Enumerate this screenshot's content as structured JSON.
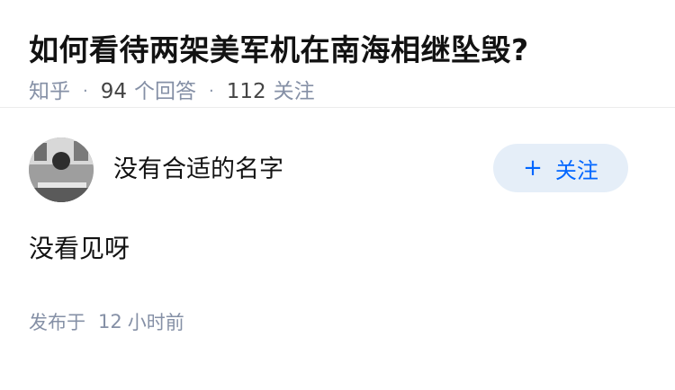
{
  "question": {
    "title": "如何看待两架美军机在南海相继坠毁?",
    "source": "知乎",
    "answer_count": "94",
    "answer_label": "个回答",
    "follower_count": "112",
    "follower_label": "关注"
  },
  "answer": {
    "author_name": "没有合适的名字",
    "follow_label": "关注",
    "follow_icon": "plus-icon",
    "content": "没看见呀",
    "published_prefix": "发布于",
    "published_num": "12",
    "published_unit": "小时前"
  },
  "colors": {
    "meta_gray": "#8590a6",
    "follow_bg": "#e5eef8",
    "follow_text": "#0066ff",
    "text": "#121212"
  }
}
